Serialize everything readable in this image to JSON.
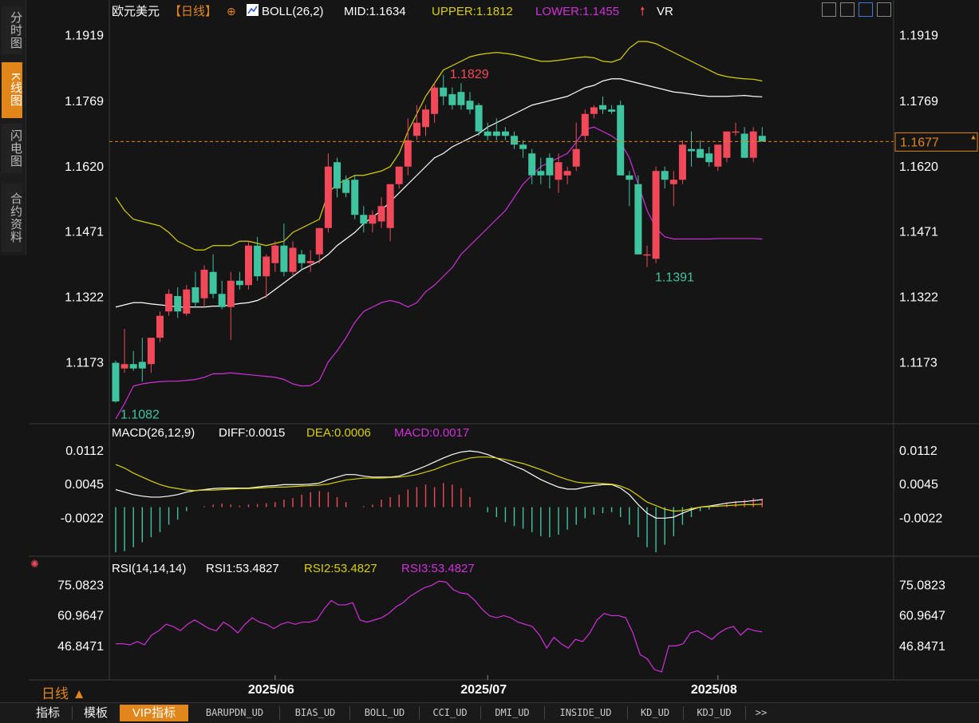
{
  "side_tabs": [
    {
      "label": "分时图",
      "active": false
    },
    {
      "label": "K线图",
      "active": true
    },
    {
      "label": "闪电图",
      "active": false
    },
    {
      "label": "合约资料",
      "active": false
    }
  ],
  "header": {
    "symbol": "欧元美元",
    "period": "【日线】",
    "boll": "BOLL(26,2)",
    "mid": "MID:1.1634",
    "upper": "UPPER:1.1812",
    "lower": "LOWER:1.1455",
    "vr": "VR"
  },
  "period_label": "日线 ▲",
  "bottom_tabs": [
    "指标",
    "模板",
    "VIP指标",
    "BARUPDN_UD",
    "BIAS_UD",
    "BOLL_UD",
    "CCI_UD",
    "DMI_UD",
    "INSIDE_UD",
    "KD_UD",
    "KDJ_UD",
    ">>"
  ],
  "colors": {
    "up": "#f2495a",
    "down": "#3fc4a0",
    "upper": "#d8d000",
    "mid": "#ffffff",
    "lower": "#d030d8",
    "orange": "#e0861a"
  },
  "chart_data": [
    {
      "type": "candlestick",
      "title": "欧元美元【日线】",
      "y_ticks": [
        "1.1919",
        "1.1769",
        "1.1620",
        "1.1471",
        "1.1322",
        "1.1173"
      ],
      "ylim": [
        1.1045,
        1.1945
      ],
      "x_ticks": [
        {
          "label": "2025/06",
          "index": 18
        },
        {
          "label": "2025/07",
          "index": 42
        },
        {
          "label": "2025/08",
          "index": 68
        }
      ],
      "current_price": "1.1677",
      "high_label": "1.1829",
      "low_label": "1.1391",
      "start_low_label": "1.1082",
      "ohlc": [
        [
          1.1173,
          1.1178,
          1.1082,
          1.1085
        ],
        [
          1.116,
          1.125,
          1.115,
          1.117
        ],
        [
          1.117,
          1.12,
          1.1155,
          1.116
        ],
        [
          1.1175,
          1.123,
          1.113,
          1.116
        ],
        [
          1.117,
          1.123,
          1.115,
          1.123
        ],
        [
          1.123,
          1.129,
          1.122,
          1.128
        ],
        [
          1.129,
          1.134,
          1.128,
          1.133
        ],
        [
          1.1325,
          1.1345,
          1.1275,
          1.129
        ],
        [
          1.1285,
          1.135,
          1.128,
          1.134
        ],
        [
          1.1345,
          1.138,
          1.13,
          1.131
        ],
        [
          1.132,
          1.1395,
          1.13,
          1.1385
        ],
        [
          1.138,
          1.142,
          1.132,
          1.133
        ],
        [
          1.133,
          1.136,
          1.1295,
          1.13
        ],
        [
          1.13,
          1.138,
          1.1225,
          1.136
        ],
        [
          1.136,
          1.138,
          1.134,
          1.135
        ],
        [
          1.135,
          1.145,
          1.134,
          1.144
        ],
        [
          1.144,
          1.146,
          1.136,
          1.137
        ],
        [
          1.137,
          1.142,
          1.132,
          1.1415
        ],
        [
          1.14,
          1.145,
          1.138,
          1.144
        ],
        [
          1.144,
          1.149,
          1.137,
          1.138
        ],
        [
          1.138,
          1.145,
          1.137,
          1.1435
        ],
        [
          1.142,
          1.143,
          1.1385,
          1.14
        ],
        [
          1.14,
          1.143,
          1.138,
          1.1405
        ],
        [
          1.142,
          1.148,
          1.14,
          1.148
        ],
        [
          1.148,
          1.165,
          1.147,
          1.162
        ],
        [
          1.163,
          1.164,
          1.155,
          1.157
        ],
        [
          1.159,
          1.16,
          1.155,
          1.156
        ],
        [
          1.159,
          1.16,
          1.15,
          1.151
        ],
        [
          1.151,
          1.153,
          1.147,
          1.149
        ],
        [
          1.149,
          1.152,
          1.147,
          1.151
        ],
        [
          1.1495,
          1.155,
          1.148,
          1.153
        ],
        [
          1.148,
          1.158,
          1.145,
          1.158
        ],
        [
          1.158,
          1.162,
          1.157,
          1.162
        ],
        [
          1.162,
          1.173,
          1.16,
          1.168
        ],
        [
          1.169,
          1.176,
          1.168,
          1.172
        ],
        [
          1.171,
          1.176,
          1.169,
          1.175
        ],
        [
          1.174,
          1.181,
          1.172,
          1.18
        ],
        [
          1.18,
          1.1829,
          1.176,
          1.178
        ],
        [
          1.1785,
          1.18,
          1.175,
          1.176
        ],
        [
          1.179,
          1.181,
          1.175,
          1.176
        ],
        [
          1.177,
          1.179,
          1.174,
          1.175
        ],
        [
          1.176,
          1.1765,
          1.169,
          1.17
        ],
        [
          1.17,
          1.172,
          1.168,
          1.169
        ],
        [
          1.17,
          1.173,
          1.168,
          1.169
        ],
        [
          1.17,
          1.171,
          1.168,
          1.169
        ],
        [
          1.169,
          1.17,
          1.166,
          1.167
        ],
        [
          1.167,
          1.168,
          1.164,
          1.166
        ],
        [
          1.165,
          1.166,
          1.158,
          1.16
        ],
        [
          1.161,
          1.164,
          1.158,
          1.16
        ],
        [
          1.164,
          1.165,
          1.157,
          1.16
        ],
        [
          1.159,
          1.165,
          1.156,
          1.163
        ],
        [
          1.16,
          1.162,
          1.158,
          1.161
        ],
        [
          1.162,
          1.172,
          1.161,
          1.166
        ],
        [
          1.169,
          1.175,
          1.168,
          1.174
        ],
        [
          1.174,
          1.176,
          1.173,
          1.1755
        ],
        [
          1.176,
          1.178,
          1.174,
          1.175
        ],
        [
          1.175,
          1.176,
          1.174,
          1.1745
        ],
        [
          1.176,
          1.177,
          1.162,
          1.16
        ],
        [
          1.16,
          1.161,
          1.153,
          1.159
        ],
        [
          1.158,
          1.16,
          1.142,
          1.142
        ],
        [
          1.142,
          1.144,
          1.1391,
          1.142
        ],
        [
          1.141,
          1.162,
          1.14,
          1.161
        ],
        [
          1.161,
          1.162,
          1.157,
          1.159
        ],
        [
          1.158,
          1.161,
          1.153,
          1.159
        ],
        [
          1.159,
          1.168,
          1.158,
          1.167
        ],
        [
          1.166,
          1.17,
          1.162,
          1.1655
        ],
        [
          1.166,
          1.168,
          1.164,
          1.164
        ],
        [
          1.165,
          1.1665,
          1.162,
          1.163
        ],
        [
          1.162,
          1.166,
          1.161,
          1.167
        ],
        [
          1.164,
          1.17,
          1.163,
          1.17
        ],
        [
          1.17,
          1.172,
          1.169,
          1.17
        ],
        [
          1.1695,
          1.171,
          1.164,
          1.164
        ],
        [
          1.164,
          1.171,
          1.163,
          1.17
        ],
        [
          1.169,
          1.171,
          1.168,
          1.1677
        ]
      ],
      "boll_upper": [
        1.155,
        1.152,
        1.15,
        1.1495,
        1.149,
        1.1485,
        1.147,
        1.145,
        1.144,
        1.143,
        1.143,
        1.144,
        1.144,
        1.144,
        1.145,
        1.145,
        1.1445,
        1.144,
        1.1445,
        1.145,
        1.147,
        1.148,
        1.149,
        1.15,
        1.156,
        1.158,
        1.159,
        1.16,
        1.16,
        1.1605,
        1.161,
        1.162,
        1.165,
        1.17,
        1.174,
        1.178,
        1.181,
        1.184,
        1.185,
        1.186,
        1.187,
        1.1875,
        1.1878,
        1.188,
        1.1878,
        1.1875,
        1.187,
        1.1865,
        1.186,
        1.186,
        1.1862,
        1.1865,
        1.1868,
        1.187,
        1.1868,
        1.186,
        1.1858,
        1.1865,
        1.189,
        1.1905,
        1.1905,
        1.19,
        1.189,
        1.188,
        1.187,
        1.186,
        1.185,
        1.184,
        1.183,
        1.1825,
        1.1822,
        1.182,
        1.1819,
        1.1815
      ],
      "boll_mid": [
        1.13,
        1.1305,
        1.131,
        1.131,
        1.1307,
        1.1305,
        1.1303,
        1.13,
        1.13,
        1.13,
        1.13,
        1.1302,
        1.1302,
        1.1305,
        1.1308,
        1.131,
        1.1315,
        1.1325,
        1.134,
        1.1355,
        1.137,
        1.1385,
        1.1395,
        1.1405,
        1.142,
        1.144,
        1.1455,
        1.147,
        1.149,
        1.1505,
        1.152,
        1.154,
        1.156,
        1.158,
        1.16,
        1.162,
        1.164,
        1.165,
        1.1665,
        1.1675,
        1.1685,
        1.1695,
        1.171,
        1.172,
        1.173,
        1.174,
        1.175,
        1.176,
        1.1765,
        1.177,
        1.1775,
        1.178,
        1.179,
        1.18,
        1.1805,
        1.1815,
        1.182,
        1.182,
        1.1815,
        1.181,
        1.1805,
        1.18,
        1.1795,
        1.179,
        1.1788,
        1.1785,
        1.1782,
        1.178,
        1.178,
        1.178,
        1.1781,
        1.1782,
        1.178,
        1.1779
      ],
      "boll_lower": [
        1.1045,
        1.108,
        1.112,
        1.1125,
        1.1128,
        1.113,
        1.1131,
        1.1131,
        1.1133,
        1.1135,
        1.114,
        1.1148,
        1.1148,
        1.115,
        1.1148,
        1.1146,
        1.1144,
        1.1142,
        1.114,
        1.1135,
        1.1125,
        1.112,
        1.1121,
        1.1133,
        1.1175,
        1.12,
        1.123,
        1.1265,
        1.129,
        1.13,
        1.131,
        1.1315,
        1.131,
        1.13,
        1.131,
        1.1335,
        1.135,
        1.137,
        1.139,
        1.142,
        1.144,
        1.146,
        1.148,
        1.15,
        1.152,
        1.155,
        1.158,
        1.16,
        1.162,
        1.163,
        1.164,
        1.165,
        1.1675,
        1.1705,
        1.171,
        1.17,
        1.169,
        1.1675,
        1.164,
        1.158,
        1.152,
        1.148,
        1.146,
        1.1455,
        1.1455,
        1.1455,
        1.1455,
        1.1455,
        1.1456,
        1.1456,
        1.1456,
        1.1456,
        1.1456,
        1.1455
      ]
    },
    {
      "type": "macd",
      "title": "MACD(26,12,9)",
      "diff_label": "DIFF:0.0015",
      "dea_label": "DEA:0.0006",
      "macd_label": "MACD:0.0017",
      "y_ticks": [
        "0.0112",
        "0.0045",
        "-0.0022"
      ],
      "ylim": [
        -0.009,
        0.0125
      ],
      "diff": [
        0.0035,
        0.003,
        0.0025,
        0.0022,
        0.002,
        0.002,
        0.0022,
        0.0025,
        0.003,
        0.0033,
        0.0035,
        0.0037,
        0.0038,
        0.0038,
        0.0038,
        0.0038,
        0.004,
        0.0042,
        0.0043,
        0.0045,
        0.0045,
        0.0045,
        0.0046,
        0.0048,
        0.0055,
        0.006,
        0.0065,
        0.0065,
        0.0062,
        0.006,
        0.006,
        0.006,
        0.0062,
        0.0068,
        0.0075,
        0.0082,
        0.009,
        0.0098,
        0.0105,
        0.011,
        0.0112,
        0.011,
        0.0105,
        0.0098,
        0.009,
        0.0082,
        0.0075,
        0.0065,
        0.0055,
        0.0047,
        0.004,
        0.0036,
        0.0036,
        0.004,
        0.0043,
        0.0045,
        0.0045,
        0.0038,
        0.0025,
        0.0005,
        -0.0012,
        -0.0022,
        -0.0022,
        -0.002,
        -0.0012,
        -0.0005,
        0.0,
        0.0002,
        0.0005,
        0.0008,
        0.001,
        0.0011,
        0.0013,
        0.0015
      ],
      "dea": [
        0.0085,
        0.0078,
        0.0068,
        0.006,
        0.0052,
        0.0045,
        0.004,
        0.0037,
        0.0034,
        0.0033,
        0.0034,
        0.0034,
        0.0035,
        0.0036,
        0.0037,
        0.0037,
        0.0038,
        0.0039,
        0.004,
        0.004,
        0.0041,
        0.0042,
        0.0043,
        0.0044,
        0.0046,
        0.005,
        0.0054,
        0.0056,
        0.0058,
        0.0058,
        0.0058,
        0.0059,
        0.006,
        0.0062,
        0.0065,
        0.007,
        0.0075,
        0.0082,
        0.0088,
        0.0093,
        0.0098,
        0.01,
        0.01,
        0.0098,
        0.0095,
        0.0091,
        0.0087,
        0.0081,
        0.0075,
        0.0068,
        0.0061,
        0.0055,
        0.005,
        0.0048,
        0.0048,
        0.0047,
        0.0046,
        0.0042,
        0.0035,
        0.0023,
        0.001,
        0.0003,
        -0.0004,
        -0.0008,
        -0.0007,
        -0.0003,
        0.0,
        0.0001,
        0.0002,
        0.0003,
        0.0004,
        0.0005,
        0.0005,
        0.0006
      ],
      "macd": [
        -0.009,
        -0.0088,
        -0.008,
        -0.007,
        -0.006,
        -0.005,
        -0.0035,
        -0.0025,
        -0.0008,
        0.0,
        0.0002,
        0.0005,
        0.0007,
        0.0005,
        0.0003,
        0.0005,
        0.0006,
        0.0008,
        0.001,
        0.0015,
        0.0018,
        0.0025,
        0.003,
        0.0032,
        0.003,
        0.002,
        0.001,
        0.0,
        0.0002,
        0.0005,
        0.0015,
        0.002,
        0.0025,
        0.0035,
        0.004,
        0.0045,
        0.004,
        0.0048,
        0.0045,
        0.0038,
        0.002,
        0.0,
        -0.001,
        -0.002,
        -0.003,
        -0.0038,
        -0.0043,
        -0.005,
        -0.0058,
        -0.006,
        -0.0055,
        -0.0045,
        -0.0035,
        -0.0022,
        -0.0015,
        -0.0012,
        -0.001,
        -0.002,
        -0.0035,
        -0.006,
        -0.008,
        -0.009,
        -0.0075,
        -0.0058,
        -0.0035,
        -0.002,
        -0.0008,
        -0.0005,
        0.0003,
        0.0008,
        0.0012,
        0.0015,
        0.0018,
        0.0017
      ]
    },
    {
      "type": "line",
      "title": "RSI(14,14,14)",
      "rsi1_label": "RSI1:53.4827",
      "rsi2_label": "RSI2:53.4827",
      "rsi3_label": "RSI3:53.4827",
      "y_ticks": [
        "75.0823",
        "60.9647",
        "46.8471"
      ],
      "ylim": [
        32,
        80
      ],
      "rsi": [
        48.0,
        48.0,
        47.5,
        49.0,
        47.5,
        52.0,
        54.0,
        57.0,
        56.0,
        54.0,
        57.0,
        59.0,
        57.0,
        55.0,
        54.0,
        58.0,
        56.0,
        53.0,
        57.0,
        60.0,
        58.0,
        57.0,
        55.0,
        57.0,
        58.0,
        57.0,
        58.0,
        58.0,
        59.0,
        64.0,
        68.0,
        66.0,
        66.0,
        67.0,
        59.0,
        58.0,
        59.0,
        60.0,
        62.0,
        65.0,
        67.0,
        70.0,
        72.0,
        74.0,
        75.0,
        77.0,
        76.5,
        73.0,
        71.5,
        71.0,
        68.0,
        64.0,
        61.0,
        60.0,
        61.0,
        60.0,
        58.0,
        57.0,
        56.0,
        52.0,
        46.0,
        51.0,
        48.0,
        46.0,
        50.0,
        49.0,
        53.0,
        59.0,
        62.0,
        61.0,
        61.0,
        60.0,
        53.0,
        43.0,
        41.0,
        36.0,
        35.0,
        47.0,
        47.0,
        48.0,
        53.0,
        54.0,
        52.0,
        50.0,
        53.0,
        55.0,
        56.0,
        52.0,
        55.0,
        54.0,
        53.4827
      ]
    }
  ]
}
